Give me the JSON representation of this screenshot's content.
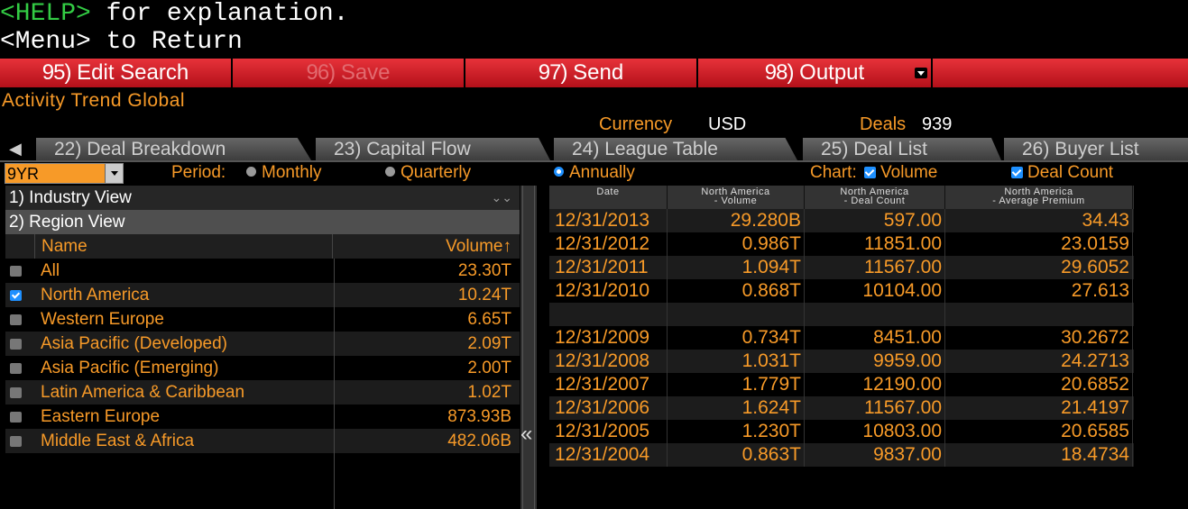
{
  "command": {
    "help_key": "<HELP>",
    "help_text": " for explanation.",
    "menu_line": "<Menu> to Return"
  },
  "fn_buttons": [
    {
      "num": "95)",
      "label": " Edit Search"
    },
    {
      "num": "96)",
      "label": " Save"
    },
    {
      "num": "97)",
      "label": " Send"
    },
    {
      "num": "98)",
      "label": " Output"
    }
  ],
  "title": "Activity Trend Global",
  "summary": {
    "currency_label": "Currency",
    "currency_value": "USD",
    "deals_label": "Deals",
    "deals_value": "939"
  },
  "tabs": [
    {
      "num": "22)",
      "label": " Deal Breakdown"
    },
    {
      "num": "23)",
      "label": " Capital Flow"
    },
    {
      "num": "24)",
      "label": " League Table"
    },
    {
      "num": "25)",
      "label": " Deal List"
    },
    {
      "num": "26)",
      "label": " Buyer List"
    }
  ],
  "controls": {
    "range_value": "9YR",
    "period_label": "Period:",
    "monthly": "Monthly",
    "quarterly": "Quarterly",
    "annually": "Annually",
    "chart_label": "Chart:",
    "volume": "Volume",
    "deal_count": "Deal Count"
  },
  "left_panel": {
    "industry_view": "1) Industry View",
    "region_view": "2) Region View",
    "col_name": "Name",
    "col_volume": "Volume↑",
    "rows": [
      {
        "name": "All",
        "volume": "23.30T",
        "checked": false
      },
      {
        "name": "North America",
        "volume": "10.24T",
        "checked": true
      },
      {
        "name": "Western Europe",
        "volume": "6.65T",
        "checked": false
      },
      {
        "name": "Asia Pacific (Developed)",
        "volume": "2.09T",
        "checked": false
      },
      {
        "name": "Asia Pacific (Emerging)",
        "volume": "2.00T",
        "checked": false
      },
      {
        "name": "Latin America & Caribbean",
        "volume": "1.02T",
        "checked": false
      },
      {
        "name": "Eastern Europe",
        "volume": "873.93B",
        "checked": false
      },
      {
        "name": "Middle East & Africa",
        "volume": "482.06B",
        "checked": false
      }
    ]
  },
  "splitter": "«",
  "right_table": {
    "headers": [
      "Date",
      "North America\n- Volume",
      "North America\n- Deal Count",
      "North America\n- Average Premium"
    ],
    "rows": [
      [
        "12/31/2013",
        "29.280B",
        "597.00",
        "34.43"
      ],
      [
        "12/31/2012",
        "0.986T",
        "11851.00",
        "23.0159"
      ],
      [
        "12/31/2011",
        "1.094T",
        "11567.00",
        "29.6052"
      ],
      [
        "12/31/2010",
        "0.868T",
        "10104.00",
        "27.613"
      ],
      [
        "",
        "",
        "",
        ""
      ],
      [
        "12/31/2009",
        "0.734T",
        "8451.00",
        "30.2672"
      ],
      [
        "12/31/2008",
        "1.031T",
        "9959.00",
        "24.2713"
      ],
      [
        "12/31/2007",
        "1.779T",
        "12190.00",
        "20.6852"
      ],
      [
        "12/31/2006",
        "1.624T",
        "11567.00",
        "21.4197"
      ],
      [
        "12/31/2005",
        "1.230T",
        "10803.00",
        "20.6585"
      ],
      [
        "12/31/2004",
        "0.863T",
        "9837.00",
        "18.4734"
      ]
    ]
  },
  "colors": {
    "accent_orange": "#f79a28",
    "fn_red": "#d42029",
    "green": "#33cc44",
    "check_blue": "#1e90ff"
  }
}
